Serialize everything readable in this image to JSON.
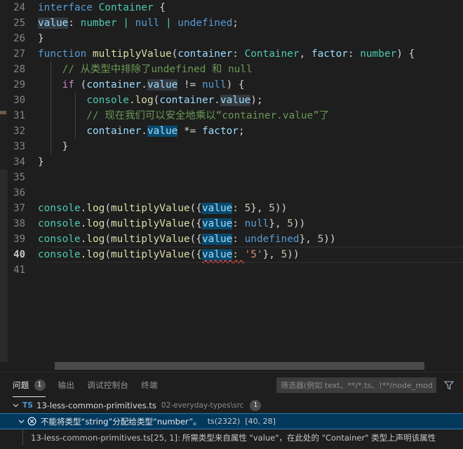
{
  "editor": {
    "language": "typescript",
    "active_line": 40,
    "lines": [
      {
        "n": 24,
        "indent_guides": 0,
        "tokens": [
          {
            "t": "interface ",
            "c": "kw"
          },
          {
            "t": "Container",
            "c": "typ"
          },
          {
            "t": " {",
            "c": "pun"
          }
        ]
      },
      {
        "n": 25,
        "indent_guides": 0,
        "tokens": [
          {
            "t": "value",
            "c": "var",
            "hl": "word"
          },
          {
            "t": ": ",
            "c": "pun"
          },
          {
            "t": "number",
            "c": "typ"
          },
          {
            "t": " | ",
            "c": "typ"
          },
          {
            "t": "null",
            "c": "kw"
          },
          {
            "t": " | ",
            "c": "typ"
          },
          {
            "t": "undefined",
            "c": "kw"
          },
          {
            "t": ";",
            "c": "pun"
          }
        ]
      },
      {
        "n": 26,
        "indent_guides": 0,
        "tokens": [
          {
            "t": "}",
            "c": "pun"
          }
        ]
      },
      {
        "n": 27,
        "indent_guides": 0,
        "tokens": [
          {
            "t": "function ",
            "c": "kw"
          },
          {
            "t": "multiplyValue",
            "c": "fn"
          },
          {
            "t": "(",
            "c": "pun"
          },
          {
            "t": "container",
            "c": "var"
          },
          {
            "t": ": ",
            "c": "pun"
          },
          {
            "t": "Container",
            "c": "typ"
          },
          {
            "t": ", ",
            "c": "pun"
          },
          {
            "t": "factor",
            "c": "var"
          },
          {
            "t": ": ",
            "c": "pun"
          },
          {
            "t": "number",
            "c": "typ"
          },
          {
            "t": ") {",
            "c": "pun"
          }
        ]
      },
      {
        "n": 28,
        "indent_guides": 1,
        "tokens": [
          {
            "t": "    // 从类型中排除了undefined 和 null",
            "c": "cmt"
          }
        ]
      },
      {
        "n": 29,
        "indent_guides": 1,
        "tokens": [
          {
            "t": "    ",
            "c": "pun"
          },
          {
            "t": "if",
            "c": "kwp"
          },
          {
            "t": " (",
            "c": "pun"
          },
          {
            "t": "container",
            "c": "var"
          },
          {
            "t": ".",
            "c": "pun"
          },
          {
            "t": "value",
            "c": "var",
            "hl": "word"
          },
          {
            "t": " != ",
            "c": "pun"
          },
          {
            "t": "null",
            "c": "kw"
          },
          {
            "t": ") {",
            "c": "pun"
          }
        ]
      },
      {
        "n": 30,
        "indent_guides": 2,
        "tokens": [
          {
            "t": "        ",
            "c": "pun"
          },
          {
            "t": "console",
            "c": "typ"
          },
          {
            "t": ".",
            "c": "pun"
          },
          {
            "t": "log",
            "c": "fn"
          },
          {
            "t": "(",
            "c": "pun"
          },
          {
            "t": "container",
            "c": "var"
          },
          {
            "t": ".",
            "c": "pun"
          },
          {
            "t": "value",
            "c": "var",
            "hl": "word"
          },
          {
            "t": ");",
            "c": "pun"
          }
        ]
      },
      {
        "n": 31,
        "indent_guides": 2,
        "tokens": [
          {
            "t": "        // 现在我们可以安全地乘以“container.value”了",
            "c": "cmt"
          }
        ]
      },
      {
        "n": 32,
        "indent_guides": 2,
        "tokens": [
          {
            "t": "        ",
            "c": "pun"
          },
          {
            "t": "container",
            "c": "var"
          },
          {
            "t": ".",
            "c": "pun"
          },
          {
            "t": "value",
            "c": "var",
            "hl": "sel"
          },
          {
            "t": " *= ",
            "c": "pun"
          },
          {
            "t": "factor",
            "c": "var"
          },
          {
            "t": ";",
            "c": "pun"
          }
        ]
      },
      {
        "n": 33,
        "indent_guides": 1,
        "tokens": [
          {
            "t": "    }",
            "c": "pun"
          }
        ]
      },
      {
        "n": 34,
        "indent_guides": 0,
        "tokens": [
          {
            "t": "}",
            "c": "pun"
          }
        ]
      },
      {
        "n": 35,
        "indent_guides": 0,
        "tokens": []
      },
      {
        "n": 36,
        "indent_guides": 0,
        "tokens": []
      },
      {
        "n": 37,
        "indent_guides": 0,
        "tokens": [
          {
            "t": "console",
            "c": "typ"
          },
          {
            "t": ".",
            "c": "pun"
          },
          {
            "t": "log",
            "c": "fn"
          },
          {
            "t": "(",
            "c": "pun"
          },
          {
            "t": "multiplyValue",
            "c": "fn"
          },
          {
            "t": "({",
            "c": "pun"
          },
          {
            "t": "value",
            "c": "var",
            "hl": "sel"
          },
          {
            "t": ": ",
            "c": "pun"
          },
          {
            "t": "5",
            "c": "num"
          },
          {
            "t": "}, ",
            "c": "pun"
          },
          {
            "t": "5",
            "c": "num"
          },
          {
            "t": "))",
            "c": "pun"
          }
        ]
      },
      {
        "n": 38,
        "indent_guides": 0,
        "tokens": [
          {
            "t": "console",
            "c": "typ"
          },
          {
            "t": ".",
            "c": "pun"
          },
          {
            "t": "log",
            "c": "fn"
          },
          {
            "t": "(",
            "c": "pun"
          },
          {
            "t": "multiplyValue",
            "c": "fn"
          },
          {
            "t": "({",
            "c": "pun"
          },
          {
            "t": "value",
            "c": "var",
            "hl": "sel"
          },
          {
            "t": ": ",
            "c": "pun"
          },
          {
            "t": "null",
            "c": "kw"
          },
          {
            "t": "}, ",
            "c": "pun"
          },
          {
            "t": "5",
            "c": "num"
          },
          {
            "t": "))",
            "c": "pun"
          }
        ]
      },
      {
        "n": 39,
        "indent_guides": 0,
        "tokens": [
          {
            "t": "console",
            "c": "typ"
          },
          {
            "t": ".",
            "c": "pun"
          },
          {
            "t": "log",
            "c": "fn"
          },
          {
            "t": "(",
            "c": "pun"
          },
          {
            "t": "multiplyValue",
            "c": "fn"
          },
          {
            "t": "({",
            "c": "pun"
          },
          {
            "t": "value",
            "c": "var",
            "hl": "sel"
          },
          {
            "t": ": ",
            "c": "pun"
          },
          {
            "t": "undefined",
            "c": "kw"
          },
          {
            "t": "}, ",
            "c": "pun"
          },
          {
            "t": "5",
            "c": "num"
          },
          {
            "t": "))",
            "c": "pun"
          }
        ]
      },
      {
        "n": 40,
        "indent_guides": 0,
        "active": true,
        "tokens": [
          {
            "t": "console",
            "c": "typ"
          },
          {
            "t": ".",
            "c": "pun"
          },
          {
            "t": "log",
            "c": "fn"
          },
          {
            "t": "(",
            "c": "pun"
          },
          {
            "t": "multiplyValue",
            "c": "fn"
          },
          {
            "t": "({",
            "c": "pun"
          },
          {
            "t": "value",
            "c": "var",
            "hl": "sel",
            "err": true
          },
          {
            "t": ": ",
            "c": "pun",
            "err": true
          },
          {
            "t": "'5'",
            "c": "str"
          },
          {
            "t": "}, ",
            "c": "pun"
          },
          {
            "t": "5",
            "c": "num"
          },
          {
            "t": "))",
            "c": "pun"
          }
        ]
      },
      {
        "n": 41,
        "indent_guides": 0,
        "tokens": []
      }
    ]
  },
  "panel": {
    "tabs": [
      {
        "label": "问题",
        "badge": "1",
        "active": true
      },
      {
        "label": "输出",
        "badge": null,
        "active": false
      },
      {
        "label": "调试控制台",
        "badge": null,
        "active": false
      },
      {
        "label": "终端",
        "badge": null,
        "active": false
      }
    ],
    "filter": {
      "value": "",
      "placeholder": "筛选器(例如 text、**/*.ts、!**/node_modules/**)"
    },
    "filter_icon": "funnel-icon",
    "problems": {
      "file": {
        "badge_language": "TS",
        "filename": "13-less-common-primitives.ts",
        "path": "02-everyday-types\\src",
        "count": "1",
        "expanded": true
      },
      "error": {
        "icon": "error-circle-icon",
        "message": "不能将类型“string”分配给类型“number”。",
        "code": "ts(2322)",
        "position": "[40, 28]",
        "selected": true,
        "expanded": true
      },
      "detail": {
        "source": "13-less-common-primitives.ts[25, 1]:",
        "text": "所需类型来自属性 \"value\"，在此处的 \"Container\" 类型上声明该属性"
      }
    }
  },
  "colors": {
    "editor_bg": "#1e1e1e",
    "selection": "#0a4a6e",
    "word_highlight": "#343a40",
    "error_squiggle": "#f14c4c",
    "selected_row": "#04395e",
    "ts_badge": "#4a9ada"
  }
}
